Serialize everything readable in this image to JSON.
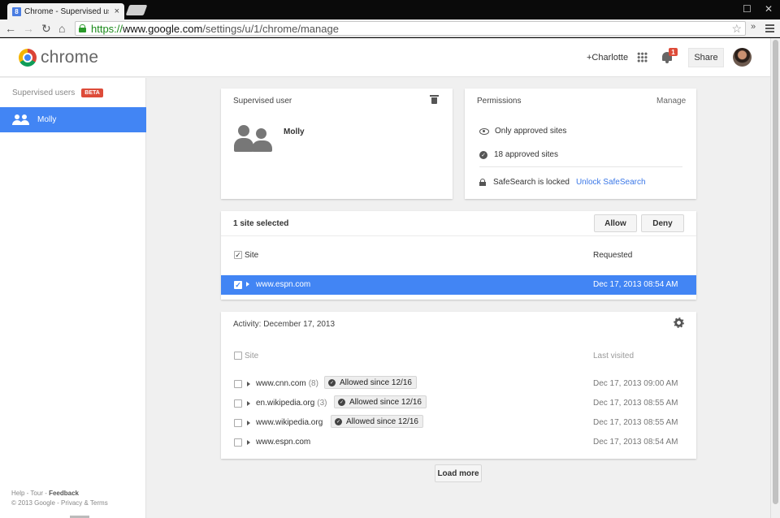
{
  "browser": {
    "tab_title": "Chrome - Supervised use",
    "tab_close": "×",
    "favicon": "8",
    "url_scheme": "https://",
    "url_host": "www.google.com",
    "url_path": "/settings/u/1/chrome/manage",
    "icons": [
      "back-arrow-icon",
      "forward-arrow-icon",
      "reload-icon",
      "home-icon",
      "star-icon",
      "menu-icon"
    ]
  },
  "header": {
    "logo_text": "chrome",
    "plus_user": "+Charlotte",
    "notification_count": "1",
    "share_label": "Share"
  },
  "sidebar": {
    "title": "Supervised users",
    "beta": "BETA",
    "items": [
      {
        "label": "Molly"
      }
    ],
    "footer_help": "Help",
    "footer_tour": "Tour",
    "footer_feedback": "Feedback",
    "footer_copyright": "© 2013 Google",
    "footer_privacy": "Privacy & Terms"
  },
  "supervised_card": {
    "title": "Supervised user",
    "name": "Molly"
  },
  "permissions_card": {
    "title": "Permissions",
    "manage": "Manage",
    "only_approved": "Only approved sites",
    "approved_count": "18 approved sites",
    "safesearch": "SafeSearch is locked",
    "unlock": "Unlock SafeSearch"
  },
  "requests_card": {
    "selected": "1 site selected",
    "allow": "Allow",
    "deny": "Deny",
    "col_site": "Site",
    "col_requested": "Requested",
    "rows": [
      {
        "site": "www.espn.com",
        "time": "Dec 17, 2013 08:54 AM",
        "checked": true
      }
    ]
  },
  "activity_card": {
    "title": "Activity: December 17, 2013",
    "col_site": "Site",
    "col_last_visited": "Last visited",
    "rows": [
      {
        "site": "www.cnn.com",
        "count": "(8)",
        "badge": "Allowed since 12/16",
        "time": "Dec 17, 2013 09:00 AM"
      },
      {
        "site": "en.wikipedia.org",
        "count": "(3)",
        "badge": "Allowed since 12/16",
        "time": "Dec 17, 2013 08:55 AM"
      },
      {
        "site": "www.wikipedia.org",
        "count": "",
        "badge": "Allowed since 12/16",
        "time": "Dec 17, 2013 08:55 AM"
      },
      {
        "site": "www.espn.com",
        "count": "",
        "badge": "",
        "time": "Dec 17, 2013 08:54 AM"
      }
    ],
    "load_more": "Load more"
  },
  "colors": {
    "accent": "#4285f4",
    "beta_badge": "#dd4b39",
    "link": "#3b78e7"
  }
}
